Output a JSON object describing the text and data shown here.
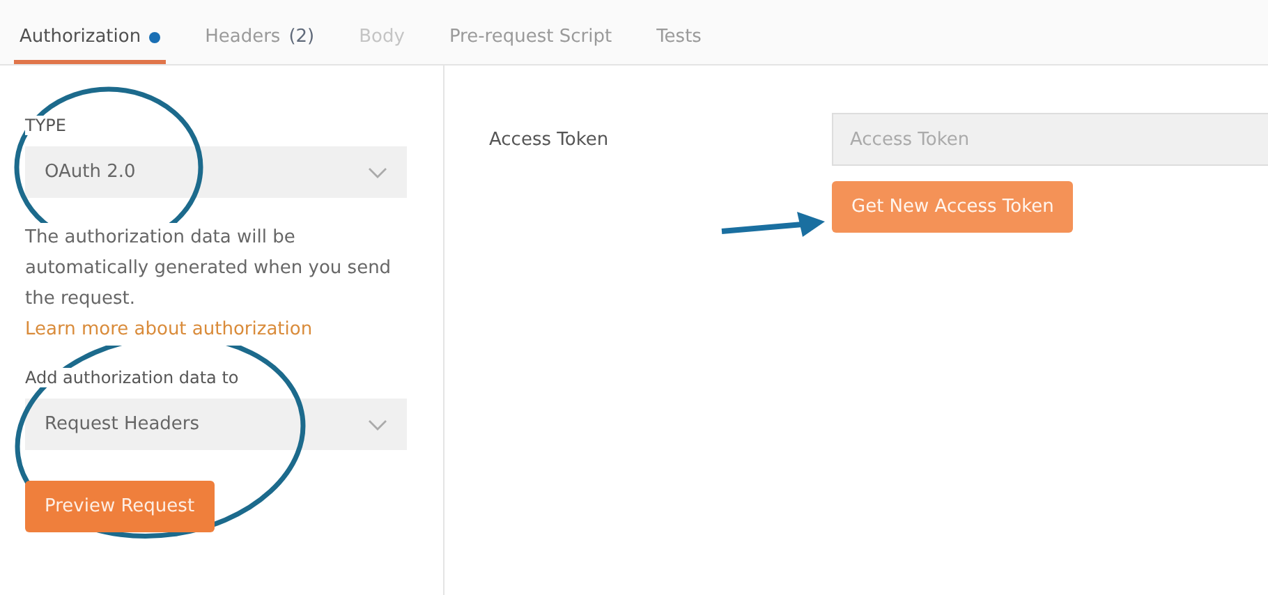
{
  "tabs": [
    {
      "label": "Authorization",
      "selected": true,
      "disabled": false,
      "dot": true
    },
    {
      "label": "Headers",
      "count": "(2)",
      "selected": false,
      "disabled": false,
      "dot": false
    },
    {
      "label": "Body",
      "selected": false,
      "disabled": true,
      "dot": false
    },
    {
      "label": "Pre-request Script",
      "selected": false,
      "disabled": false,
      "dot": false
    },
    {
      "label": "Tests",
      "selected": false,
      "disabled": false,
      "dot": false
    }
  ],
  "sidebar": {
    "type_label": "TYPE",
    "type_value": "OAuth 2.0",
    "description": "The authorization data will be automatically generated when you send the request. ",
    "learn_more_link": "Learn more about authorization",
    "add_to_label": "Add authorization data to",
    "add_to_value": "Request Headers",
    "preview_button": "Preview Request"
  },
  "main": {
    "access_token_label": "Access Token",
    "access_token_placeholder": "Access Token",
    "get_token_button": "Get New Access Token"
  }
}
